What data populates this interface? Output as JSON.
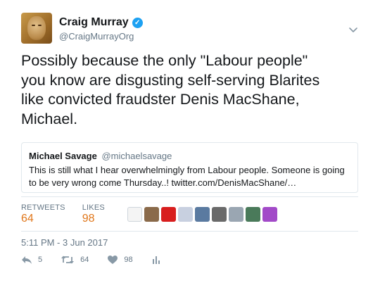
{
  "author": {
    "display_name": "Craig Murray",
    "handle": "@CraigMurrayOrg",
    "verified": true
  },
  "tweet": {
    "text": "Possibly because the only \"Labour people\"\nyou know are disgusting self-serving Blarites\nlike convicted fraudster Denis MacShane,\nMichael."
  },
  "quoted_tweet": {
    "display_name": "Michael Savage",
    "handle": "@michaelsavage",
    "text": "This is still what I hear overwhelmingly from Labour people. Someone is going to be very wrong come Thursday..! twitter.com/DenisMacShane/…"
  },
  "stats": {
    "retweets_label": "RETWEETS",
    "retweets_value": "64",
    "likes_label": "LIKES",
    "likes_value": "98",
    "accent_color": "#e0771b"
  },
  "likers": [
    {
      "icon": "avatar-sketch",
      "color": "#f4f4f4"
    },
    {
      "icon": "avatar-sunset",
      "color": "#8a6a4a"
    },
    {
      "icon": "avatar-red",
      "color": "#d81e1e"
    },
    {
      "icon": "avatar-flag",
      "color": "#c8d0e0"
    },
    {
      "icon": "avatar-map",
      "color": "#5a7aa0"
    },
    {
      "icon": "avatar-people",
      "color": "#6a6a6a"
    },
    {
      "icon": "avatar-default",
      "color": "#9aa6b2"
    },
    {
      "icon": "avatar-green",
      "color": "#4a7a5a"
    },
    {
      "icon": "avatar-purple",
      "color": "#a24ac8"
    }
  ],
  "timestamp": "5:11 PM - 3 Jun 2017",
  "actions": {
    "reply_count": "5",
    "retweet_count": "64",
    "like_count": "98"
  },
  "icons": {
    "verified": "verified-badge-icon",
    "caret": "chevron-down-icon",
    "reply": "reply-icon",
    "retweet": "retweet-icon",
    "like": "heart-icon",
    "analytics": "analytics-icon"
  }
}
